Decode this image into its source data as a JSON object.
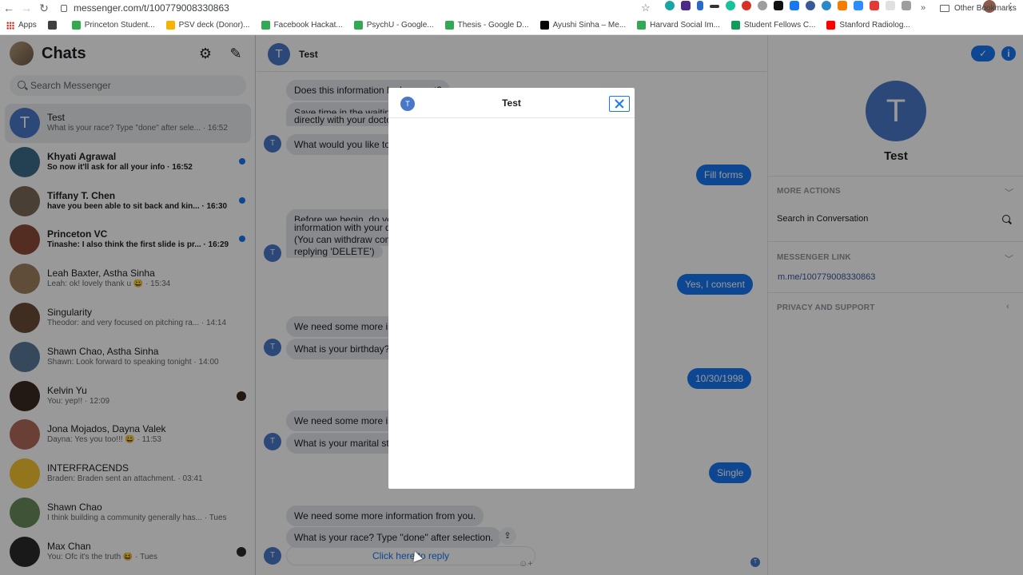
{
  "browser": {
    "url": "messenger.com/t/100779008330863",
    "bookmarks": [
      {
        "label": "Apps",
        "color": "#d93025"
      },
      {
        "label": "",
        "color": "#3c4043"
      },
      {
        "label": "Princeton Student...",
        "color": "#34a853"
      },
      {
        "label": "PSV deck (Donor)...",
        "color": "#f4b400"
      },
      {
        "label": "Facebook Hackat...",
        "color": "#34a853"
      },
      {
        "label": "PsychU - Google...",
        "color": "#34a853"
      },
      {
        "label": "Thesis - Google D...",
        "color": "#34a853"
      },
      {
        "label": "Ayushi Sinha – Me...",
        "color": "#000000"
      },
      {
        "label": "Harvard Social Im...",
        "color": "#34a853"
      },
      {
        "label": "Student Fellows C...",
        "color": "#0f9d58"
      },
      {
        "label": "Stanford Radiolog...",
        "color": "#ff0000"
      }
    ],
    "more_bookmarks": "»",
    "other_bookmarks": "Other Bookmarks"
  },
  "sidebar": {
    "title": "Chats",
    "search_placeholder": "Search Messenger",
    "chats": [
      {
        "name": "Test",
        "preview": "What is your race? Type \"done\" after sele... · 16:52",
        "avatar": "T",
        "active": true,
        "unread": false
      },
      {
        "name": "Khyati Agrawal",
        "preview": "So now it'll ask for all your info · 16:52",
        "unread": true,
        "color": "#3d6b8a"
      },
      {
        "name": "Tiffany T. Chen",
        "preview": "have you been able to sit back and kin... · 16:30",
        "unread": true,
        "color": "#7a6a58"
      },
      {
        "name": "Princeton VC",
        "preview": "Tinashe: I also think the first slide is pr... · 16:29",
        "unread": true,
        "color": "#8a4c3a"
      },
      {
        "name": "Leah Baxter, Astha Sinha",
        "preview": "Leah: ok! lovely thank u 😀 · 15:34",
        "unread": false,
        "color": "#a08060"
      },
      {
        "name": "Singularity",
        "preview": "Theodor: and very focused on pitching ra... · 14:14",
        "unread": false,
        "color": "#6a4c3a"
      },
      {
        "name": "Shawn Chao, Astha Sinha",
        "preview": "Shawn: Look forward to speaking tonight · 14:00",
        "unread": false,
        "color": "#5a7a9a"
      },
      {
        "name": "Kelvin Yu",
        "preview": "You: yep!! · 12:09",
        "unread": false,
        "color": "#3a2a22",
        "seen": true
      },
      {
        "name": "Jona Mojados, Dayna Valek",
        "preview": "Dayna: Yes you too!!! 😀 · 11:53",
        "unread": false,
        "color": "#b06a5a"
      },
      {
        "name": "INTERFRACENDS",
        "preview": "Braden: Braden sent an attachment. · 03:41",
        "unread": false,
        "color": "#f4c430"
      },
      {
        "name": "Shawn Chao",
        "preview": "I think building a community generally has... · Tues",
        "unread": false,
        "color": "#6a8a5a"
      },
      {
        "name": "Max Chan",
        "preview": "You: Ofc it's the truth 😆 · Tues",
        "unread": false,
        "color": "#2a2a2a",
        "seen": true
      }
    ]
  },
  "conversation": {
    "title": "Test",
    "avatar_letter": "T",
    "messages": [
      {
        "dir": "in",
        "text": "Does this information look correct?"
      },
      {
        "dir": "in",
        "text": "Save time in the waiting"
      },
      {
        "dir": "in",
        "text": "directly with your docto"
      },
      {
        "dir": "in",
        "text": "What would you like to"
      },
      {
        "dir": "out",
        "text": "Fill forms"
      },
      {
        "dir": "in",
        "text": "Before we begin, do you"
      },
      {
        "dir": "in",
        "text": "information with your do"
      },
      {
        "dir": "in",
        "text": "(You can withdraw cons"
      },
      {
        "dir": "in",
        "text": "replying 'DELETE')"
      },
      {
        "dir": "out",
        "text": "Yes, I consent"
      },
      {
        "dir": "in",
        "text": "We need some more inf"
      },
      {
        "dir": "in",
        "text": "What is your birthday? ("
      },
      {
        "dir": "out",
        "text": "10/30/1998"
      },
      {
        "dir": "in",
        "text": "We need some more inf"
      },
      {
        "dir": "in",
        "text": "What is your marital sta"
      },
      {
        "dir": "out",
        "text": "Single"
      },
      {
        "dir": "in",
        "text": "We need some more information from you."
      },
      {
        "dir": "in",
        "text": "What is your race? Type \"done\" after selection."
      }
    ],
    "reply_link": "Click here to reply"
  },
  "info_panel": {
    "name": "Test",
    "avatar_letter": "T",
    "more_actions": "MORE ACTIONS",
    "search_in_conversation": "Search in Conversation",
    "messenger_link_title": "MESSENGER LINK",
    "messenger_link": "m.me/100779008330863",
    "privacy": "PRIVACY AND SUPPORT"
  },
  "modal": {
    "title": "Test",
    "avatar_letter": "T"
  },
  "colors": {
    "accent": "#1877f2",
    "avatar_blue": "#4a78c8"
  }
}
